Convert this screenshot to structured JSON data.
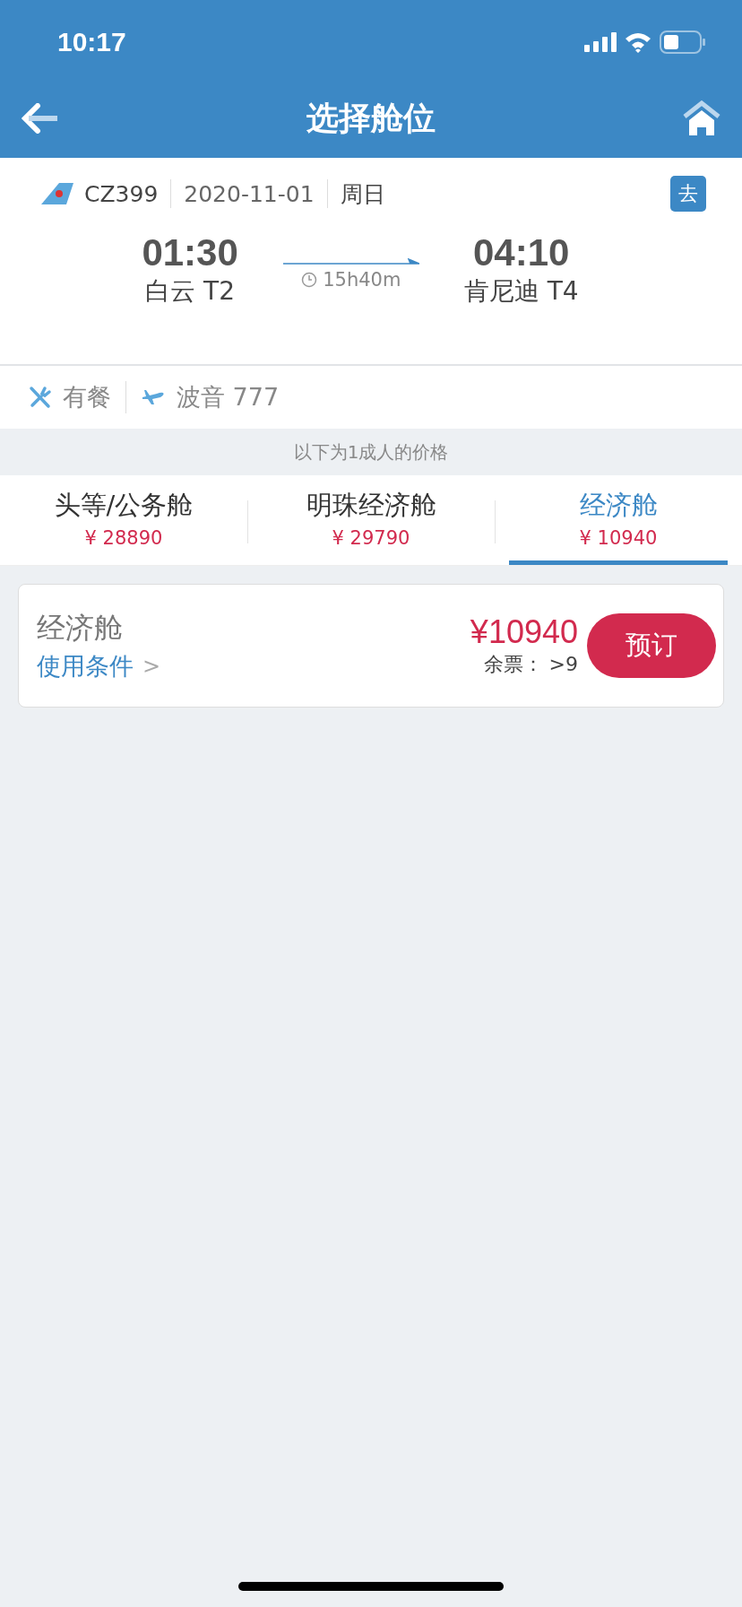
{
  "status_bar": {
    "time": "10:17"
  },
  "nav": {
    "title": "选择舱位"
  },
  "flight": {
    "number": "CZ399",
    "date": "2020-11-01",
    "weekday": "周日",
    "direction_badge": "去",
    "depart_time": "01:30",
    "depart_airport": "白云 T2",
    "duration": "15h40m",
    "arrive_time": "04:10",
    "arrive_airport": "肯尼迪 T4"
  },
  "facilities": [
    {
      "kind": "meal",
      "label": "有餐"
    },
    {
      "kind": "aircraft",
      "label": "波音 777"
    }
  ],
  "price_note": "以下为1成人的价格",
  "tabs": [
    {
      "label": "头等/公务舱",
      "price": "¥ 28890",
      "selected": false
    },
    {
      "label": "明珠经济舱",
      "price": "¥ 29790",
      "selected": false
    },
    {
      "label": "经济舱",
      "price": "¥ 10940",
      "selected": true
    }
  ],
  "fares": [
    {
      "cabin": "经济舱",
      "conditions_link": "使用条件",
      "conditions_arrow": ">",
      "price": "¥10940",
      "remaining": "余票： >9",
      "button": "预订"
    }
  ]
}
